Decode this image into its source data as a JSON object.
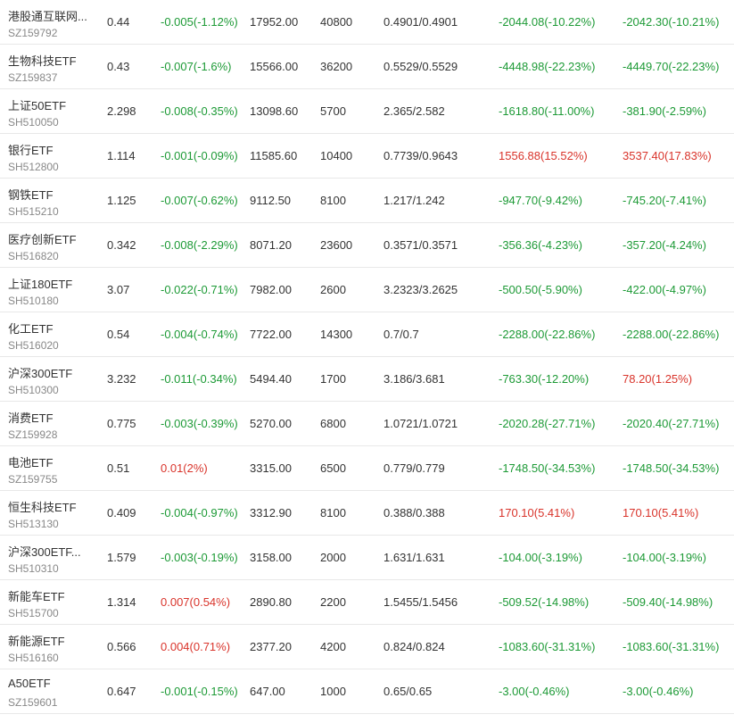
{
  "colors": {
    "up": "#d9342b",
    "down": "#1d9a36",
    "text": "#333333",
    "subtext": "#888888",
    "divider": "#e8e8e8"
  },
  "rows": [
    {
      "name": "港股通互联网...",
      "code": "SZ159792",
      "price": "0.44",
      "change": "-0.005(-1.12%)",
      "change_dir": "down",
      "market_value": "17952.00",
      "quantity": "40800",
      "cost": "0.4901/0.4901",
      "pl1": "-2044.08(-10.22%)",
      "pl1_dir": "down",
      "pl2": "-2042.30(-10.21%)",
      "pl2_dir": "down"
    },
    {
      "name": "生物科技ETF",
      "code": "SZ159837",
      "price": "0.43",
      "change": "-0.007(-1.6%)",
      "change_dir": "down",
      "market_value": "15566.00",
      "quantity": "36200",
      "cost": "0.5529/0.5529",
      "pl1": "-4448.98(-22.23%)",
      "pl1_dir": "down",
      "pl2": "-4449.70(-22.23%)",
      "pl2_dir": "down"
    },
    {
      "name": "上证50ETF",
      "code": "SH510050",
      "price": "2.298",
      "change": "-0.008(-0.35%)",
      "change_dir": "down",
      "market_value": "13098.60",
      "quantity": "5700",
      "cost": "2.365/2.582",
      "pl1": "-1618.80(-11.00%)",
      "pl1_dir": "down",
      "pl2": "-381.90(-2.59%)",
      "pl2_dir": "down"
    },
    {
      "name": "银行ETF",
      "code": "SH512800",
      "price": "1.114",
      "change": "-0.001(-0.09%)",
      "change_dir": "down",
      "market_value": "11585.60",
      "quantity": "10400",
      "cost": "0.7739/0.9643",
      "pl1": "1556.88(15.52%)",
      "pl1_dir": "up",
      "pl2": "3537.40(17.83%)",
      "pl2_dir": "up"
    },
    {
      "name": "钢铁ETF",
      "code": "SH515210",
      "price": "1.125",
      "change": "-0.007(-0.62%)",
      "change_dir": "down",
      "market_value": "9112.50",
      "quantity": "8100",
      "cost": "1.217/1.242",
      "pl1": "-947.70(-9.42%)",
      "pl1_dir": "down",
      "pl2": "-745.20(-7.41%)",
      "pl2_dir": "down"
    },
    {
      "name": "医疗创新ETF",
      "code": "SH516820",
      "price": "0.342",
      "change": "-0.008(-2.29%)",
      "change_dir": "down",
      "market_value": "8071.20",
      "quantity": "23600",
      "cost": "0.3571/0.3571",
      "pl1": "-356.36(-4.23%)",
      "pl1_dir": "down",
      "pl2": "-357.20(-4.24%)",
      "pl2_dir": "down"
    },
    {
      "name": "上证180ETF",
      "code": "SH510180",
      "price": "3.07",
      "change": "-0.022(-0.71%)",
      "change_dir": "down",
      "market_value": "7982.00",
      "quantity": "2600",
      "cost": "3.2323/3.2625",
      "pl1": "-500.50(-5.90%)",
      "pl1_dir": "down",
      "pl2": "-422.00(-4.97%)",
      "pl2_dir": "down"
    },
    {
      "name": "化工ETF",
      "code": "SH516020",
      "price": "0.54",
      "change": "-0.004(-0.74%)",
      "change_dir": "down",
      "market_value": "7722.00",
      "quantity": "14300",
      "cost": "0.7/0.7",
      "pl1": "-2288.00(-22.86%)",
      "pl1_dir": "down",
      "pl2": "-2288.00(-22.86%)",
      "pl2_dir": "down"
    },
    {
      "name": "沪深300ETF",
      "code": "SH510300",
      "price": "3.232",
      "change": "-0.011(-0.34%)",
      "change_dir": "down",
      "market_value": "5494.40",
      "quantity": "1700",
      "cost": "3.186/3.681",
      "pl1": "-763.30(-12.20%)",
      "pl1_dir": "down",
      "pl2": "78.20(1.25%)",
      "pl2_dir": "up"
    },
    {
      "name": "消费ETF",
      "code": "SZ159928",
      "price": "0.775",
      "change": "-0.003(-0.39%)",
      "change_dir": "down",
      "market_value": "5270.00",
      "quantity": "6800",
      "cost": "1.0721/1.0721",
      "pl1": "-2020.28(-27.71%)",
      "pl1_dir": "down",
      "pl2": "-2020.40(-27.71%)",
      "pl2_dir": "down"
    },
    {
      "name": "电池ETF",
      "code": "SZ159755",
      "price": "0.51",
      "change": "0.01(2%)",
      "change_dir": "up",
      "market_value": "3315.00",
      "quantity": "6500",
      "cost": "0.779/0.779",
      "pl1": "-1748.50(-34.53%)",
      "pl1_dir": "down",
      "pl2": "-1748.50(-34.53%)",
      "pl2_dir": "down"
    },
    {
      "name": "恒生科技ETF",
      "code": "SH513130",
      "price": "0.409",
      "change": "-0.004(-0.97%)",
      "change_dir": "down",
      "market_value": "3312.90",
      "quantity": "8100",
      "cost": "0.388/0.388",
      "pl1": "170.10(5.41%)",
      "pl1_dir": "up",
      "pl2": "170.10(5.41%)",
      "pl2_dir": "up"
    },
    {
      "name": "沪深300ETF...",
      "code": "SH510310",
      "price": "1.579",
      "change": "-0.003(-0.19%)",
      "change_dir": "down",
      "market_value": "3158.00",
      "quantity": "2000",
      "cost": "1.631/1.631",
      "pl1": "-104.00(-3.19%)",
      "pl1_dir": "down",
      "pl2": "-104.00(-3.19%)",
      "pl2_dir": "down"
    },
    {
      "name": "新能车ETF",
      "code": "SH515700",
      "price": "1.314",
      "change": "0.007(0.54%)",
      "change_dir": "up",
      "market_value": "2890.80",
      "quantity": "2200",
      "cost": "1.5455/1.5456",
      "pl1": "-509.52(-14.98%)",
      "pl1_dir": "down",
      "pl2": "-509.40(-14.98%)",
      "pl2_dir": "down"
    },
    {
      "name": "新能源ETF",
      "code": "SH516160",
      "price": "0.566",
      "change": "0.004(0.71%)",
      "change_dir": "up",
      "market_value": "2377.20",
      "quantity": "4200",
      "cost": "0.824/0.824",
      "pl1": "-1083.60(-31.31%)",
      "pl1_dir": "down",
      "pl2": "-1083.60(-31.31%)",
      "pl2_dir": "down"
    },
    {
      "name": "A50ETF",
      "code": "SZ159601",
      "price": "0.647",
      "change": "-0.001(-0.15%)",
      "change_dir": "down",
      "market_value": "647.00",
      "quantity": "1000",
      "cost": "0.65/0.65",
      "pl1": "-3.00(-0.46%)",
      "pl1_dir": "down",
      "pl2": "-3.00(-0.46%)",
      "pl2_dir": "down"
    }
  ]
}
